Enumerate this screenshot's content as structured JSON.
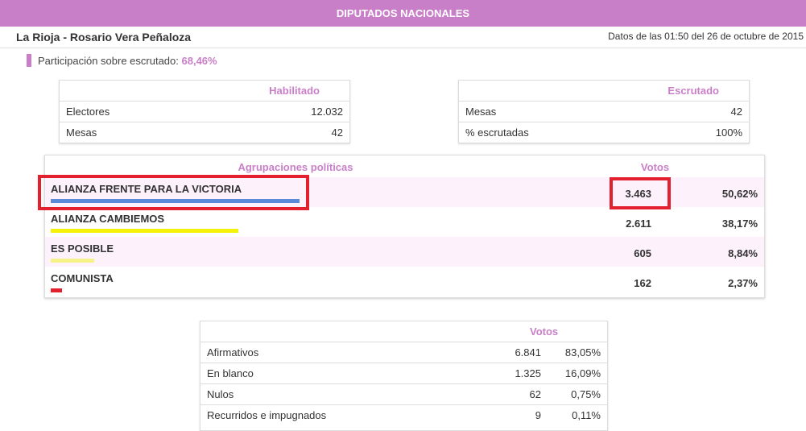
{
  "header": {
    "title": "DIPUTADOS NACIONALES"
  },
  "location": "La Rioja - Rosario Vera Peñaloza",
  "timestamp": "Datos de las 01:50 del 26 de octubre de 2015",
  "participation": {
    "label": "Participación sobre escrutado:",
    "value": "68,46%"
  },
  "habilitado": {
    "title": "Habilitado",
    "rows": [
      {
        "label": "Electores",
        "value": "12.032"
      },
      {
        "label": "Mesas",
        "value": "42"
      }
    ]
  },
  "escrutado": {
    "title": "Escrutado",
    "rows": [
      {
        "label": "Mesas",
        "value": "42"
      },
      {
        "label": "% escrutadas",
        "value": "100%"
      }
    ]
  },
  "parties": {
    "header_name": "Agrupaciones políticas",
    "header_votes": "Votos",
    "rows": [
      {
        "name": "ALIANZA FRENTE PARA LA VICTORIA",
        "votes": "3.463",
        "pct": "50,62%",
        "share": 0.5062,
        "color": "#5b8bd8"
      },
      {
        "name": "ALIANZA CAMBIEMOS",
        "votes": "2.611",
        "pct": "38,17%",
        "share": 0.3817,
        "color": "#f7f20a"
      },
      {
        "name": "ES POSIBLE",
        "votes": "605",
        "pct": "8,84%",
        "share": 0.0884,
        "color": "#f6f28a"
      },
      {
        "name": "COMUNISTA",
        "votes": "162",
        "pct": "2,37%",
        "share": 0.0237,
        "color": "#e3202d"
      }
    ]
  },
  "votes_summary": {
    "title": "Votos",
    "rows": [
      {
        "label": "Afirmativos",
        "votes": "6.841",
        "pct": "83,05%"
      },
      {
        "label": "En blanco",
        "votes": "1.325",
        "pct": "16,09%"
      },
      {
        "label": "Nulos",
        "votes": "62",
        "pct": "0,75%"
      },
      {
        "label": "Recurridos e impugnados",
        "votes": "9",
        "pct": "0,11%"
      }
    ]
  },
  "colors": {
    "accent": "#c97fc8",
    "highlight": "#e3202d",
    "row_alt": "#fdf1fc"
  }
}
